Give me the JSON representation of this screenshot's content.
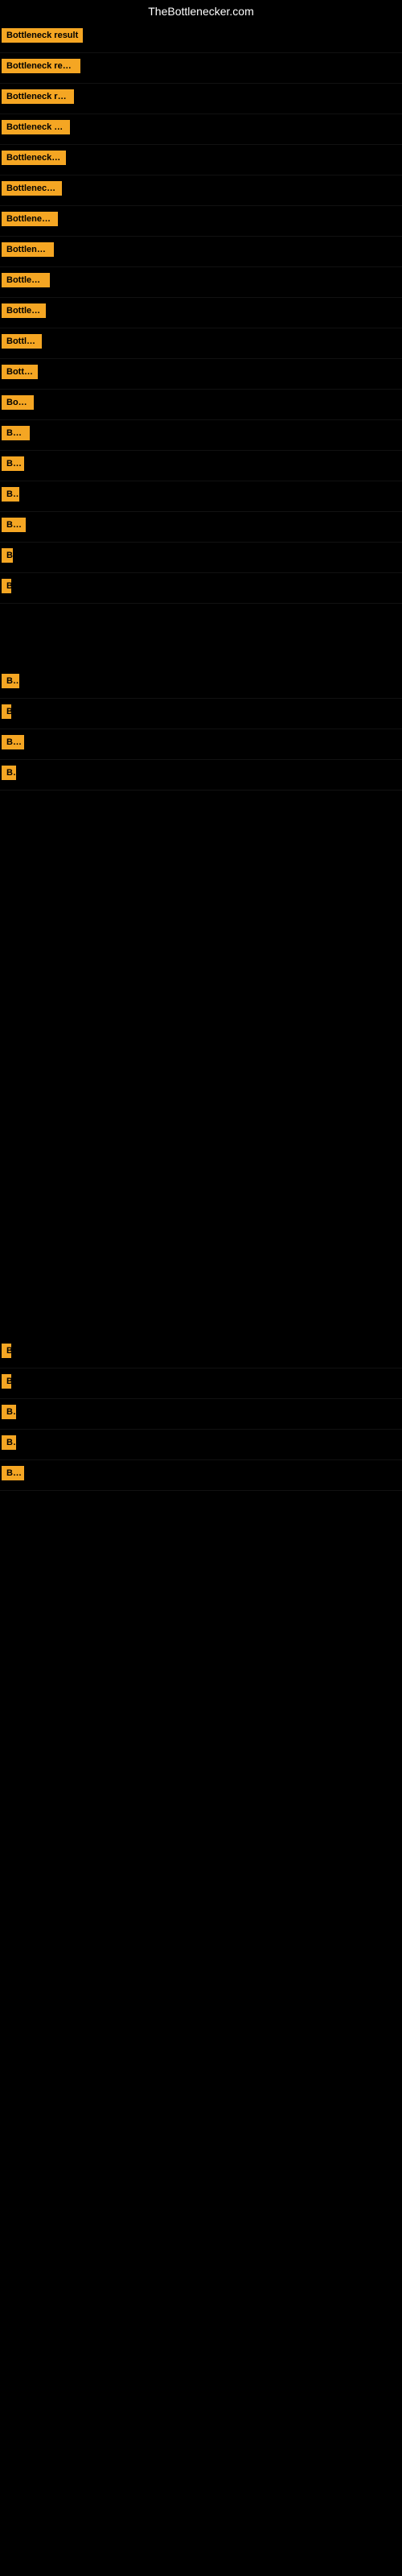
{
  "site": {
    "title": "TheBottlenecker.com"
  },
  "badge_text": "Bottleneck result",
  "rows": [
    {
      "id": 1,
      "badge_class": "badge-w1",
      "spacer": false
    },
    {
      "id": 2,
      "badge_class": "badge-w2",
      "spacer": false
    },
    {
      "id": 3,
      "badge_class": "badge-w3",
      "spacer": false
    },
    {
      "id": 4,
      "badge_class": "badge-w4",
      "spacer": false
    },
    {
      "id": 5,
      "badge_class": "badge-w5",
      "spacer": false
    },
    {
      "id": 6,
      "badge_class": "badge-w6",
      "spacer": false
    },
    {
      "id": 7,
      "badge_class": "badge-w7",
      "spacer": false
    },
    {
      "id": 8,
      "badge_class": "badge-w8",
      "spacer": false
    },
    {
      "id": 9,
      "badge_class": "badge-w9",
      "spacer": false
    },
    {
      "id": 10,
      "badge_class": "badge-w10",
      "spacer": false
    },
    {
      "id": 11,
      "badge_class": "badge-w11",
      "spacer": false
    },
    {
      "id": 12,
      "badge_class": "badge-w12",
      "spacer": false
    },
    {
      "id": 13,
      "badge_class": "badge-w13",
      "spacer": false
    },
    {
      "id": 14,
      "badge_class": "badge-w14",
      "spacer": false
    },
    {
      "id": 15,
      "badge_class": "badge-w15",
      "spacer": false
    },
    {
      "id": 16,
      "badge_class": "badge-w16",
      "spacer": false
    },
    {
      "id": 17,
      "badge_class": "badge-w17",
      "spacer": false
    },
    {
      "id": 18,
      "badge_class": "badge-w18",
      "spacer": false
    },
    {
      "id": 19,
      "badge_class": "badge-w19",
      "spacer": "large"
    },
    {
      "id": 20,
      "badge_class": "badge-w20",
      "spacer": false
    },
    {
      "id": 21,
      "badge_class": "badge-w21",
      "spacer": false
    },
    {
      "id": 22,
      "badge_class": "badge-w22",
      "spacer": false
    },
    {
      "id": 23,
      "badge_class": "badge-w23",
      "spacer": "large"
    }
  ]
}
